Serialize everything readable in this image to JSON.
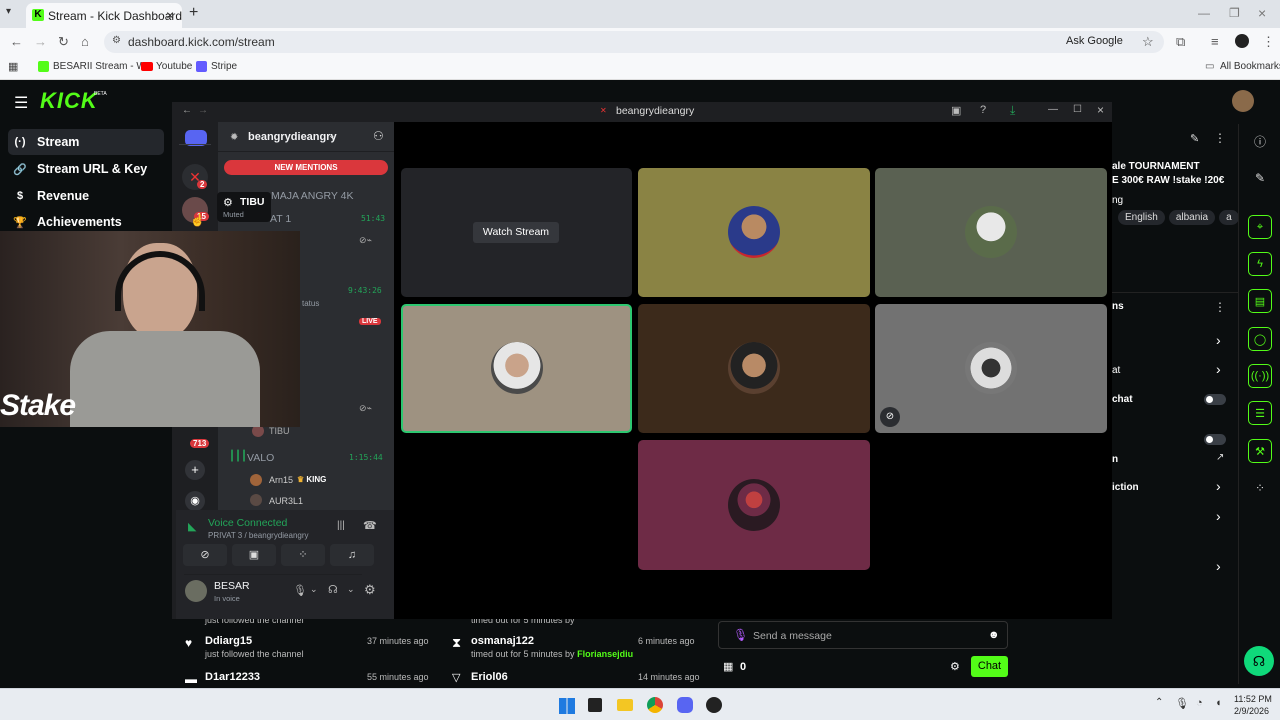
{
  "browser": {
    "tab_title": "Stream - Kick Dashboard",
    "url": "dashboard.kick.com/stream",
    "ask_google": "Ask Google",
    "bookmarks": [
      "BESARII Stream - W...",
      "Youtube",
      "Stripe"
    ],
    "all_bookmarks": "All Bookmarks"
  },
  "kick": {
    "logo": "KICK",
    "beta": "BETA",
    "nav": [
      {
        "label": "Stream",
        "icon": "broadcast-icon"
      },
      {
        "label": "Stream URL & Key",
        "icon": "key-icon"
      },
      {
        "label": "Revenue",
        "icon": "dollar-icon"
      },
      {
        "label": "Achievements",
        "icon": "trophy-icon"
      }
    ],
    "stream_title_1": "ale TOURNAMENT",
    "stream_title_2": "E 300€ RAW !stake !20€",
    "stream_title_3": "ng",
    "tags": [
      "English",
      "albania",
      "a"
    ],
    "section_label": "ns",
    "rows": [
      "at",
      "chat",
      "",
      "n",
      "iction",
      "",
      ""
    ]
  },
  "discord": {
    "window_title": "beangrydieangry",
    "server_name": "beangrydieangry",
    "new_mentions": "NEW MENTIONS",
    "tooltip_name": "TIBU",
    "tooltip_status": "Muted",
    "guild_badges": [
      "2",
      "15",
      "713"
    ],
    "channels": [
      {
        "name": "MAJA ANGRY 4K",
        "time": ""
      },
      {
        "name": "AT 1",
        "time": "51:43"
      },
      {
        "name": "",
        "time": "9:43:26"
      },
      {
        "name": "VALO",
        "time": "1:15:44"
      }
    ],
    "status_text": "tatus",
    "live_badge": "LIVE",
    "voice_users": [
      {
        "name": "TIBU",
        "badge": ""
      },
      {
        "name": "Arn15",
        "badge": "KING"
      },
      {
        "name": "AUR3L1",
        "badge": ""
      }
    ],
    "voice_connected": "Voice Connected",
    "voice_channel": "PRIVAT 3 / beangrydieangry",
    "user_name": "BESAR",
    "user_status": "In voice",
    "watch_stream": "Watch Stream"
  },
  "feed": {
    "left": [
      {
        "title": "",
        "sub": "just followed the channel",
        "time": ""
      },
      {
        "title": "Ddiarg15",
        "sub": "just followed the channel",
        "time": "37 minutes ago"
      },
      {
        "title": "D1ar12233",
        "sub": "",
        "time": "55 minutes ago"
      }
    ],
    "right": [
      {
        "title": "",
        "sub": "timed out for 5 minutes by",
        "time": ""
      },
      {
        "title": "osmanaj122",
        "sub": "timed out for 5 minutes by",
        "by": "Floriansejdiu",
        "time": "6 minutes ago"
      },
      {
        "title": "Eriol06",
        "sub": "",
        "time": "14 minutes ago"
      }
    ]
  },
  "chat": {
    "placeholder": "Send a message",
    "count": "0",
    "button": "Chat"
  },
  "cam": {
    "overlay": "Stake"
  },
  "taskbar": {
    "time": "11:52 PM",
    "date": "2/9/2026"
  },
  "colors": {
    "kick_green": "#53fc18",
    "discord_bg": "#2b2d31",
    "speaking_outline": "#2dc770",
    "mention_red": "#da373c"
  }
}
